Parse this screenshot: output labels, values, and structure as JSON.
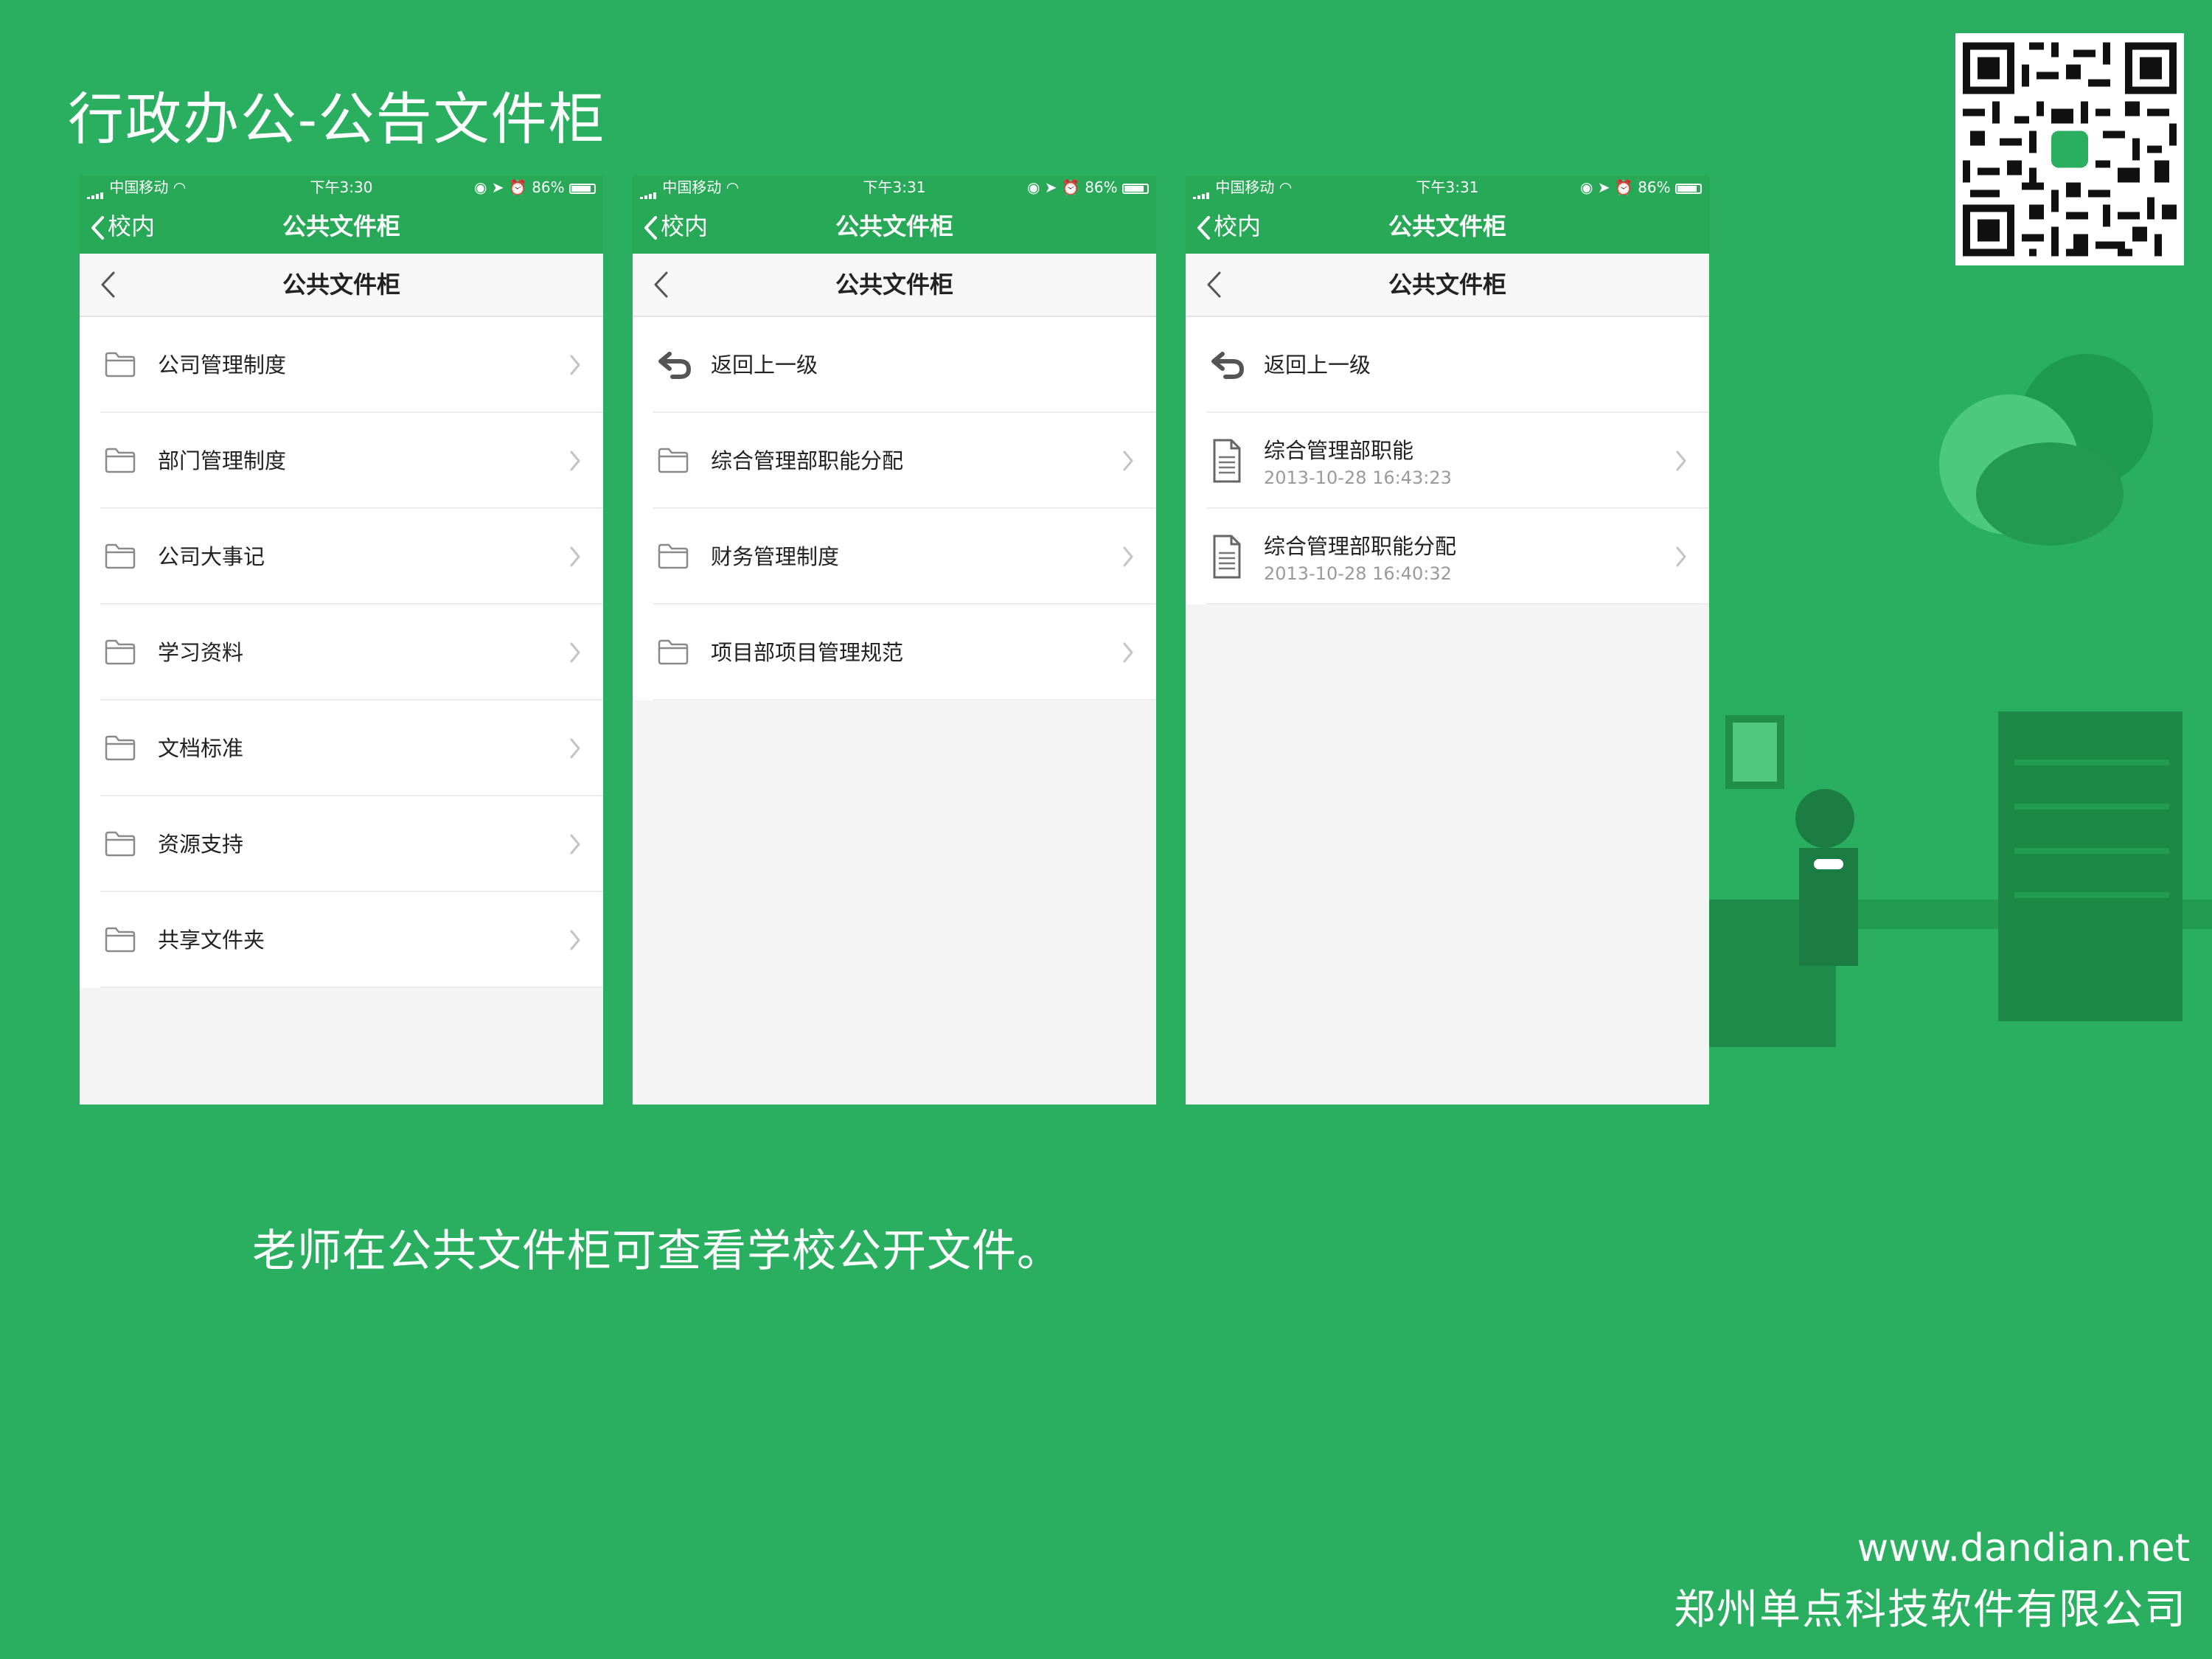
{
  "slide": {
    "title": "行政办公-公告文件柜",
    "caption": "老师在公共文件柜可查看学校公开文件。",
    "footer_url": "www.dandian.net",
    "footer_company": "郑州单点科技软件有限公司"
  },
  "colors": {
    "background": "#2aae60",
    "nav_green": "#27a957",
    "list_bg": "#ffffff",
    "page_bg": "#f4f4f4"
  },
  "screens": [
    {
      "status": {
        "carrier": "中国移动",
        "time": "下午3:30",
        "battery": "86%",
        "battery_level": 0.86
      },
      "nav": {
        "back_label": "校内",
        "title": "公共文件柜"
      },
      "header": {
        "title": "公共文件柜"
      },
      "rows": [
        {
          "icon": "folder-icon",
          "label": "公司管理制度"
        },
        {
          "icon": "folder-icon",
          "label": "部门管理制度"
        },
        {
          "icon": "folder-icon",
          "label": "公司大事记"
        },
        {
          "icon": "folder-icon",
          "label": "学习资料"
        },
        {
          "icon": "folder-icon",
          "label": "文档标准"
        },
        {
          "icon": "folder-icon",
          "label": "资源支持"
        },
        {
          "icon": "folder-icon",
          "label": "共享文件夹"
        }
      ]
    },
    {
      "status": {
        "carrier": "中国移动",
        "time": "下午3:31",
        "battery": "86%",
        "battery_level": 0.86
      },
      "nav": {
        "back_label": "校内",
        "title": "公共文件柜"
      },
      "header": {
        "title": "公共文件柜"
      },
      "rows": [
        {
          "icon": "return-icon",
          "label": "返回上一级"
        },
        {
          "icon": "folder-icon",
          "label": "综合管理部职能分配"
        },
        {
          "icon": "folder-icon",
          "label": "财务管理制度"
        },
        {
          "icon": "folder-icon",
          "label": "项目部项目管理规范"
        }
      ]
    },
    {
      "status": {
        "carrier": "中国移动",
        "time": "下午3:31",
        "battery": "86%",
        "battery_level": 0.86
      },
      "nav": {
        "back_label": "校内",
        "title": "公共文件柜"
      },
      "header": {
        "title": "公共文件柜"
      },
      "rows": [
        {
          "icon": "return-icon",
          "label": "返回上一级"
        },
        {
          "icon": "document-icon",
          "label": "综合管理部职能",
          "date": "2013-10-28 16:43:23"
        },
        {
          "icon": "document-icon",
          "label": "综合管理部职能分配",
          "date": "2013-10-28 16:40:32"
        }
      ]
    }
  ]
}
